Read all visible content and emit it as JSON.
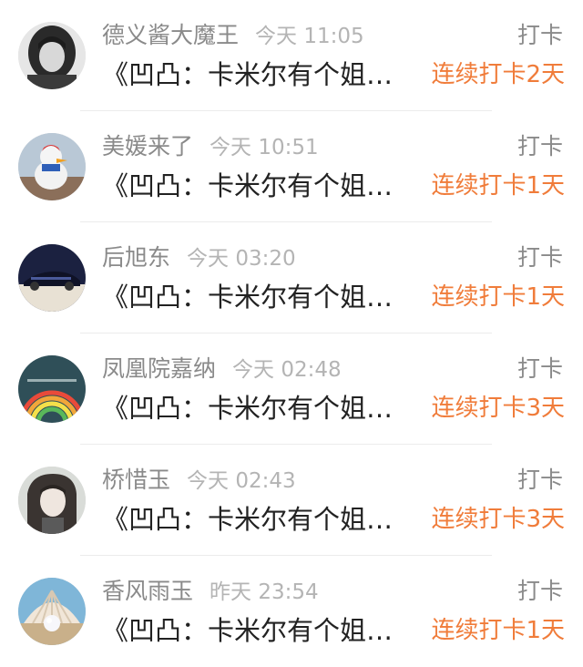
{
  "items": [
    {
      "avatar_icon": "avatar-girl-bw",
      "name": "德义酱大魔王",
      "time": "今天 11:05",
      "action": "打卡",
      "text": "《凹凸：卡米尔有个姐姐》",
      "streak": "连续打卡2天"
    },
    {
      "avatar_icon": "avatar-duck-toy",
      "name": "美媛来了",
      "time": "今天 10:51",
      "action": "打卡",
      "text": "《凹凸：卡米尔有个姐姐》",
      "streak": "连续打卡1天"
    },
    {
      "avatar_icon": "avatar-sports-car",
      "name": "后旭东",
      "time": "今天 03:20",
      "action": "打卡",
      "text": "《凹凸：卡米尔有个姐姐》",
      "streak": "连续打卡1天"
    },
    {
      "avatar_icon": "avatar-rainbow",
      "name": "凤凰院嘉纳",
      "time": "今天 02:48",
      "action": "打卡",
      "text": "《凹凸：卡米尔有个姐姐》",
      "streak": "连续打卡3天"
    },
    {
      "avatar_icon": "avatar-anime-girl",
      "name": "桥惜玉",
      "time": "今天 02:43",
      "action": "打卡",
      "text": "《凹凸：卡米尔有个姐姐》",
      "streak": "连续打卡3天"
    },
    {
      "avatar_icon": "avatar-pearl-shell",
      "name": "香风雨玉",
      "time": "昨天 23:54",
      "action": "打卡",
      "text": "《凹凸：卡米尔有个姐姐》",
      "streak": "连续打卡1天"
    }
  ],
  "colors": {
    "streak": "#f07c3a",
    "name": "#8a8a8a",
    "time": "#b4b4b4",
    "text": "#222222"
  }
}
